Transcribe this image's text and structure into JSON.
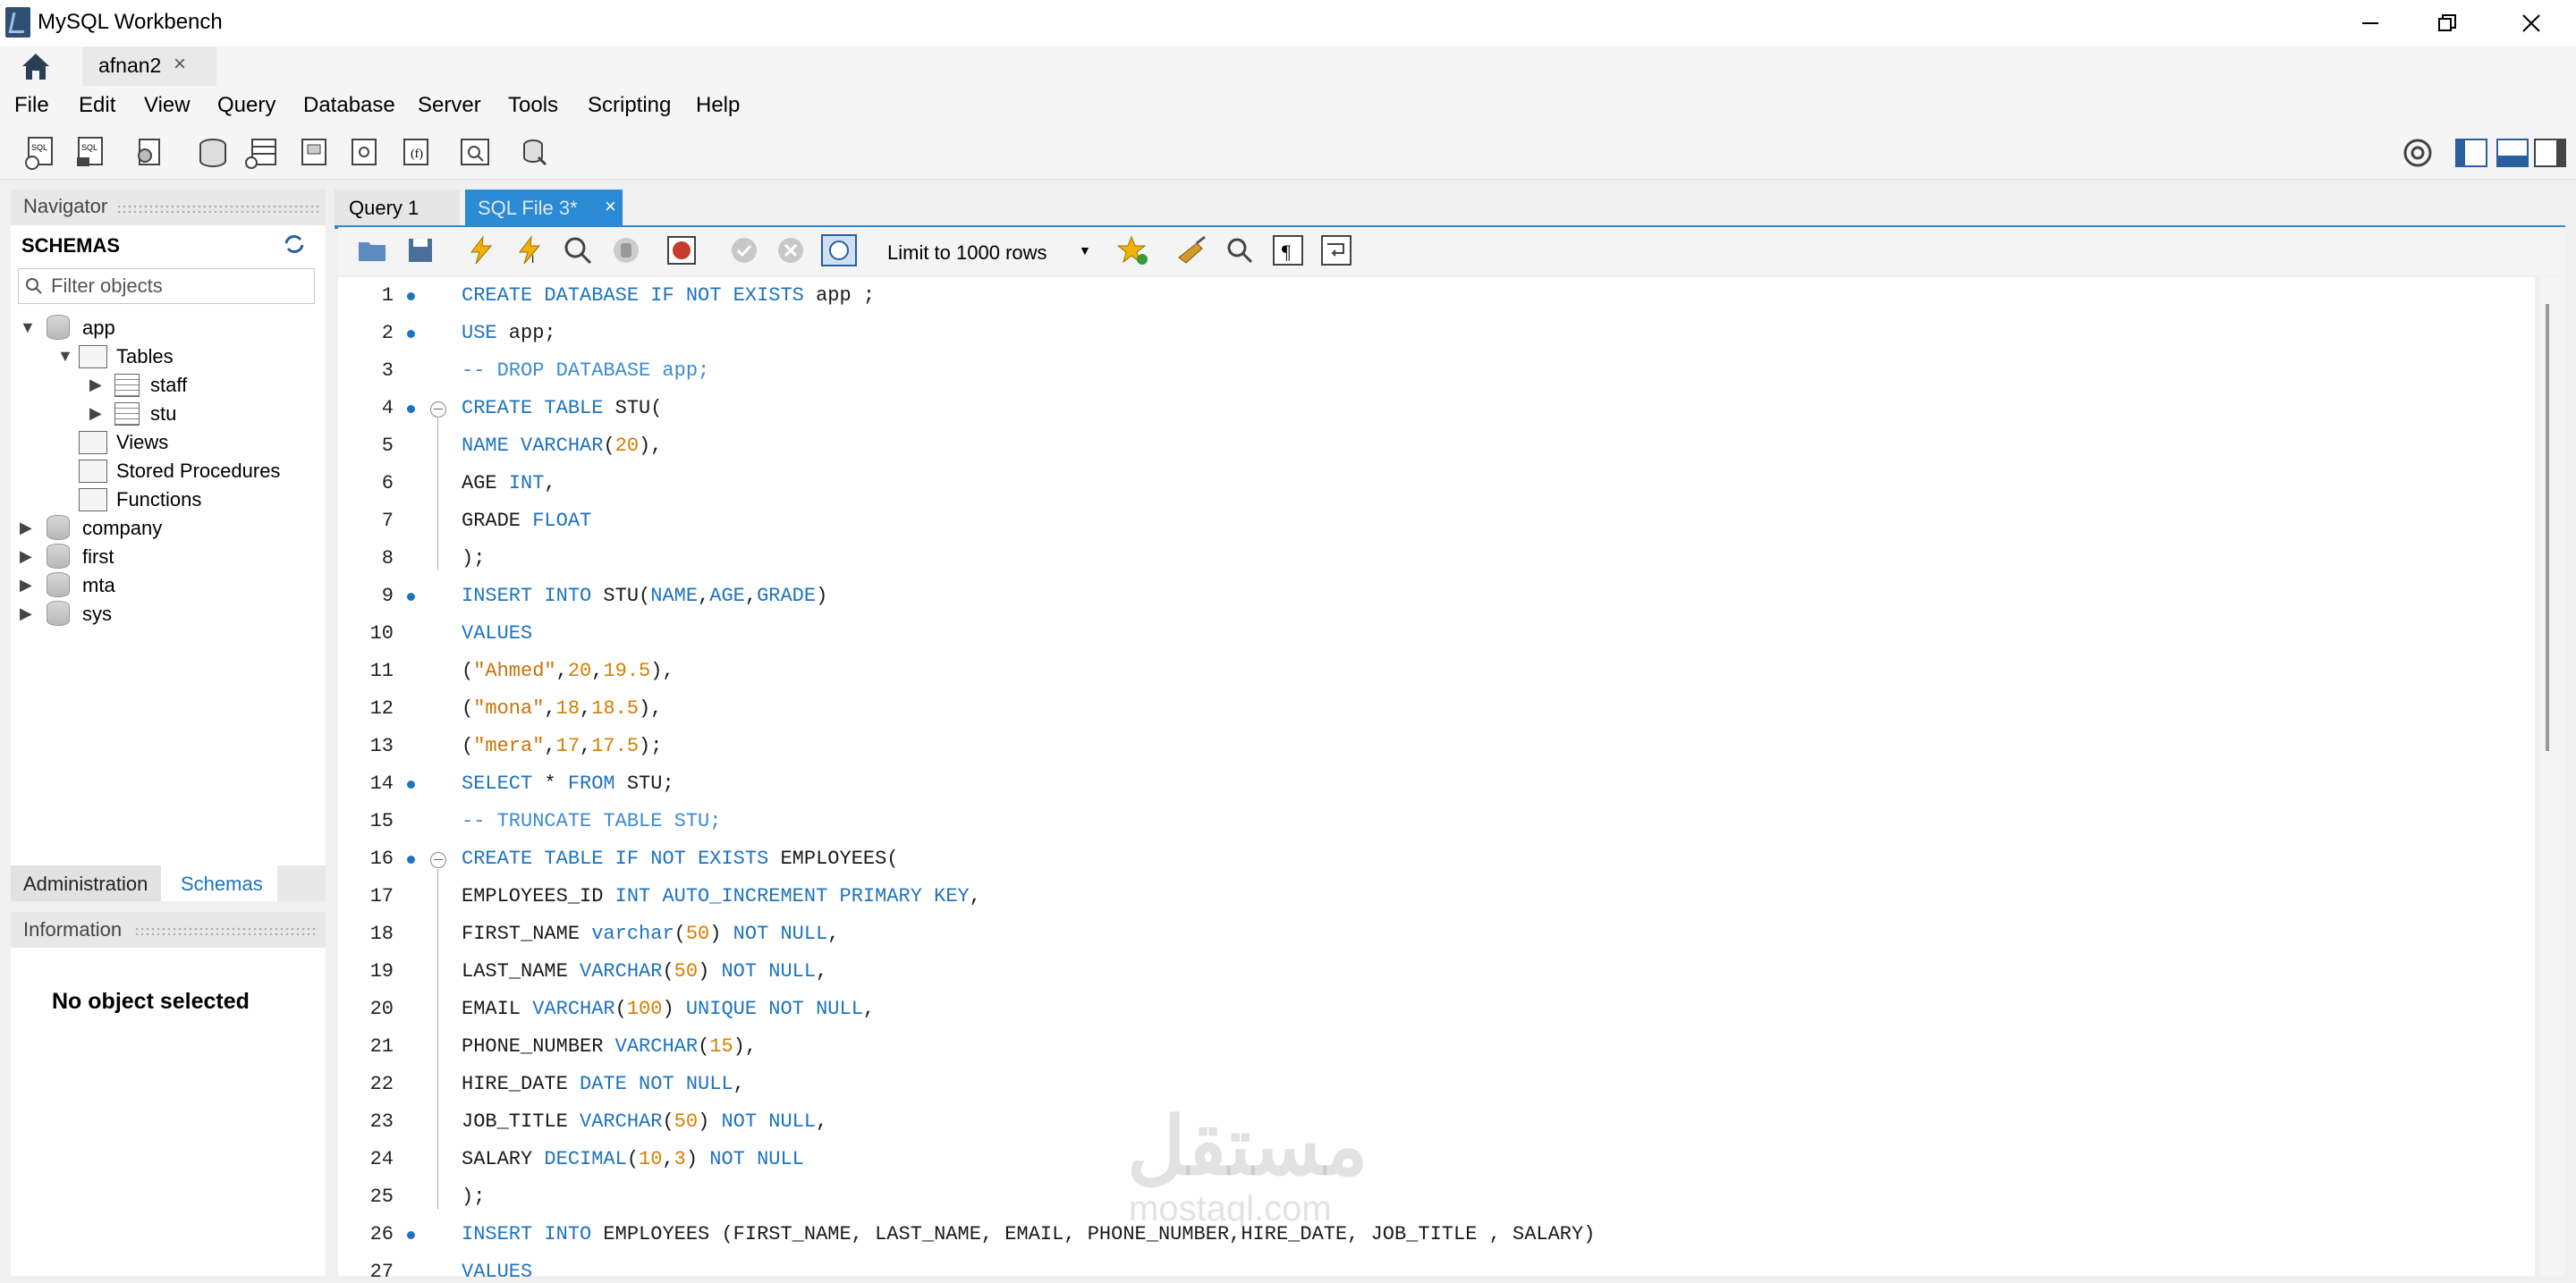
{
  "window": {
    "title": "MySQL Workbench"
  },
  "connection_tab": {
    "label": "afnan2",
    "close": "×"
  },
  "menu": [
    "File",
    "Edit",
    "View",
    "Query",
    "Database",
    "Server",
    "Tools",
    "Scripting",
    "Help"
  ],
  "navigator": {
    "title": "Navigator",
    "schemas_title": "SCHEMAS",
    "filter_placeholder": "Filter objects",
    "tree": {
      "app": "app",
      "tables": "Tables",
      "staff": "staff",
      "stu": "stu",
      "views": "Views",
      "procs": "Stored Procedures",
      "funcs": "Functions",
      "company": "company",
      "first": "first",
      "mta": "mta",
      "sys": "sys"
    },
    "tabs": {
      "admin": "Administration",
      "schemas": "Schemas"
    },
    "info_title": "Information",
    "no_object": "No object selected"
  },
  "editor": {
    "tabs": [
      "Query 1",
      "SQL File 3*"
    ],
    "limit": "Limit to 1000 rows",
    "lines": [
      "CREATE DATABASE IF NOT EXISTS app ;",
      "USE app;",
      "-- DROP DATABASE app;",
      "CREATE TABLE STU(",
      "NAME VARCHAR(20),",
      "AGE INT,",
      "GRADE FLOAT",
      ");",
      "INSERT INTO STU(NAME,AGE,GRADE)",
      "VALUES",
      "(\"Ahmed\",20,19.5),",
      "(\"mona\",18,18.5),",
      "(\"mera\",17,17.5);",
      "SELECT * FROM STU;",
      "-- TRUNCATE TABLE STU;",
      "CREATE TABLE IF NOT EXISTS EMPLOYEES(",
      "EMPLOYEES_ID INT AUTO_INCREMENT PRIMARY KEY,",
      "FIRST_NAME varchar(50) NOT NULL,",
      "LAST_NAME VARCHAR(50) NOT NULL,",
      "EMAIL VARCHAR(100) UNIQUE NOT NULL,",
      "PHONE_NUMBER VARCHAR(15),",
      "HIRE_DATE DATE NOT NULL,",
      "JOB_TITLE VARCHAR(50) NOT NULL,",
      "SALARY DECIMAL(10,3) NOT NULL",
      ");",
      "INSERT INTO EMPLOYEES (FIRST_NAME, LAST_NAME, EMAIL, PHONE_NUMBER,HIRE_DATE, JOB_TITLE , SALARY)",
      "VALUES"
    ]
  },
  "watermark": {
    "main": "مستقل",
    "sub": "mostaql.com"
  },
  "colors": {
    "keyword": "#1e73be",
    "number": "#d87d00",
    "comment": "#3d8ccf",
    "accent": "#2a8ad4"
  }
}
